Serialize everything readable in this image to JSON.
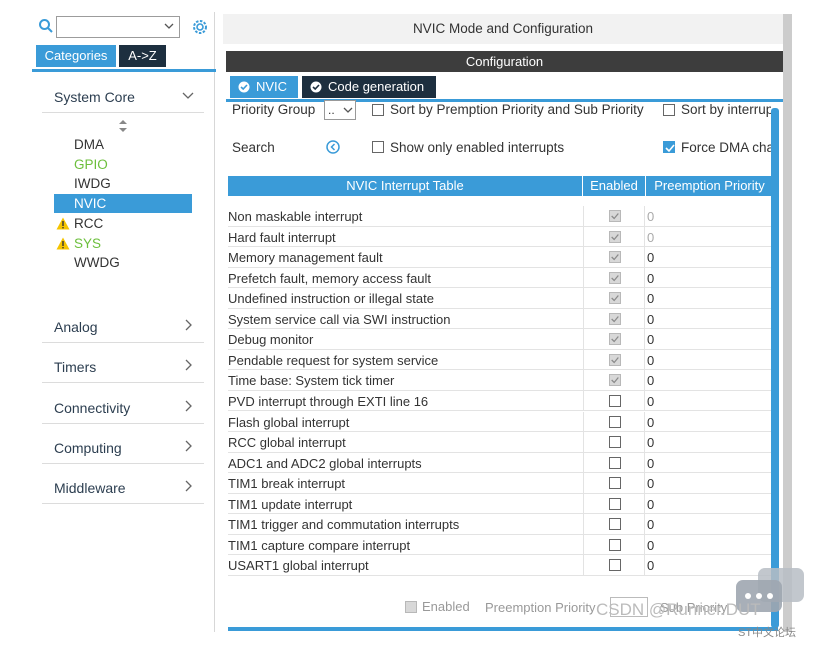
{
  "sidebar": {
    "tabs": {
      "categories": "Categories",
      "az": "A->Z"
    },
    "system_core": {
      "header": "System Core",
      "items": [
        {
          "label": "DMA",
          "color": "#333333",
          "warning": false
        },
        {
          "label": "GPIO",
          "color": "#6cbf3c",
          "warning": false
        },
        {
          "label": "IWDG",
          "color": "#333333",
          "warning": false
        },
        {
          "label": "NVIC",
          "color": "#ffffff",
          "warning": false,
          "selected": true
        },
        {
          "label": "RCC",
          "color": "#333333",
          "warning": true
        },
        {
          "label": "SYS",
          "color": "#6cbf3c",
          "warning": true
        },
        {
          "label": "WWDG",
          "color": "#333333",
          "warning": false
        }
      ]
    },
    "categories": [
      "Analog",
      "Timers",
      "Connectivity",
      "Computing",
      "Middleware"
    ]
  },
  "window": {
    "title": "NVIC Mode and Configuration",
    "config_label": "Configuration"
  },
  "subtabs": {
    "nvic": "NVIC",
    "code_generation": "Code generation"
  },
  "controls": {
    "priority_group_label": "Priority Group",
    "priority_group_value": "..",
    "sort_premption": "Sort by Premption Priority and Sub Priority",
    "sort_interrupt": "Sort by interrup",
    "search_label": "Search",
    "show_enabled": "Show only enabled interrupts",
    "force_dma": "Force DMA cha",
    "force_dma_checked": true
  },
  "table": {
    "headers": [
      "NVIC Interrupt Table",
      "Enabled",
      "Preemption Priority"
    ],
    "rows": [
      {
        "name": "Non maskable interrupt",
        "enabled": "grey",
        "priority": "0",
        "dim": true
      },
      {
        "name": "Hard fault interrupt",
        "enabled": "grey",
        "priority": "0",
        "dim": true
      },
      {
        "name": "Memory management fault",
        "enabled": "grey",
        "priority": "0",
        "dim": false
      },
      {
        "name": "Prefetch fault, memory access fault",
        "enabled": "grey",
        "priority": "0",
        "dim": false
      },
      {
        "name": "Undefined instruction or illegal state",
        "enabled": "grey",
        "priority": "0",
        "dim": false
      },
      {
        "name": "System service call via SWI instruction",
        "enabled": "grey",
        "priority": "0",
        "dim": false
      },
      {
        "name": "Debug monitor",
        "enabled": "grey",
        "priority": "0",
        "dim": false
      },
      {
        "name": "Pendable request for system service",
        "enabled": "grey",
        "priority": "0",
        "dim": false
      },
      {
        "name": "Time base: System tick timer",
        "enabled": "grey",
        "priority": "0",
        "dim": false
      },
      {
        "name": "PVD interrupt through EXTI line 16",
        "enabled": "off",
        "priority": "0",
        "dim": false
      },
      {
        "name": "Flash global interrupt",
        "enabled": "off",
        "priority": "0",
        "dim": false
      },
      {
        "name": "RCC global interrupt",
        "enabled": "off",
        "priority": "0",
        "dim": false
      },
      {
        "name": "ADC1 and ADC2 global interrupts",
        "enabled": "off",
        "priority": "0",
        "dim": false
      },
      {
        "name": "TIM1 break interrupt",
        "enabled": "off",
        "priority": "0",
        "dim": false
      },
      {
        "name": "TIM1 update interrupt",
        "enabled": "off",
        "priority": "0",
        "dim": false
      },
      {
        "name": "TIM1 trigger and commutation interrupts",
        "enabled": "off",
        "priority": "0",
        "dim": false
      },
      {
        "name": "TIM1 capture compare interrupt",
        "enabled": "off",
        "priority": "0",
        "dim": false
      },
      {
        "name": "USART1 global interrupt",
        "enabled": "off",
        "priority": "0",
        "dim": false
      }
    ]
  },
  "bottom": {
    "enabled_label": "Enabled",
    "preemption_label": "Preemption Priority",
    "sub_priority_label": "Sub Priority"
  },
  "watermark": "CSDN @Runner.DUT",
  "forum_label": "ST中文论坛",
  "colors": {
    "accent": "#3a9bd8",
    "dark_tab": "#1d2f3f",
    "green": "#6cbf3c",
    "warning": "#f5c400"
  }
}
